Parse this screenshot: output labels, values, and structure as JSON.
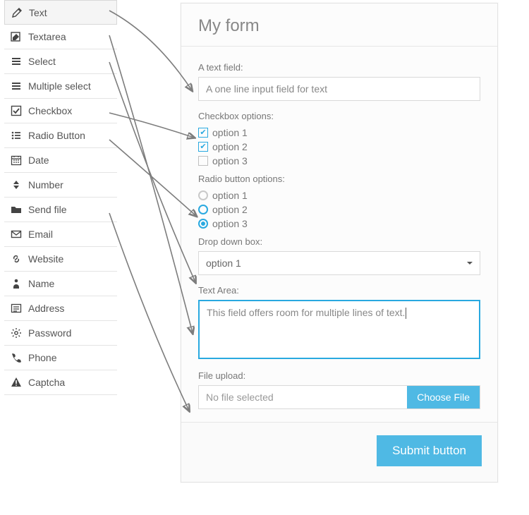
{
  "palette": {
    "items": [
      {
        "label": "Text",
        "icon": "pencil"
      },
      {
        "label": "Textarea",
        "icon": "edit"
      },
      {
        "label": "Select",
        "icon": "bars"
      },
      {
        "label": "Multiple select",
        "icon": "bars"
      },
      {
        "label": "Checkbox",
        "icon": "check-square"
      },
      {
        "label": "Radio Button",
        "icon": "list-bullets"
      },
      {
        "label": "Date",
        "icon": "calendar"
      },
      {
        "label": "Number",
        "icon": "sort"
      },
      {
        "label": "Send file",
        "icon": "folder"
      },
      {
        "label": "Email",
        "icon": "envelope"
      },
      {
        "label": "Website",
        "icon": "link"
      },
      {
        "label": "Name",
        "icon": "person"
      },
      {
        "label": "Address",
        "icon": "lines-box"
      },
      {
        "label": "Password",
        "icon": "gear"
      },
      {
        "label": "Phone",
        "icon": "phone"
      },
      {
        "label": "Captcha",
        "icon": "warning"
      }
    ]
  },
  "form": {
    "title": "My form",
    "text_field": {
      "label": "A text field:",
      "value": "A one line input field for text"
    },
    "checkbox_group": {
      "label": "Checkbox options:",
      "options": [
        {
          "label": "option 1",
          "checked": true
        },
        {
          "label": "option 2",
          "checked": true
        },
        {
          "label": "option 3",
          "checked": false
        }
      ]
    },
    "radio_group": {
      "label": "Radio button options:",
      "options": [
        {
          "label": "option 1",
          "selected": false,
          "outlined": false
        },
        {
          "label": "option 2",
          "selected": false,
          "outlined": true
        },
        {
          "label": "option 3",
          "selected": true,
          "outlined": true
        }
      ]
    },
    "dropdown": {
      "label": "Drop down box:",
      "selected": "option 1"
    },
    "textarea": {
      "label": "Text Area:",
      "value": "This field offers room for multiple lines of text."
    },
    "file": {
      "label": "File upload:",
      "placeholder": "No file selected",
      "button": "Choose File"
    },
    "submit_label": "Submit button"
  }
}
